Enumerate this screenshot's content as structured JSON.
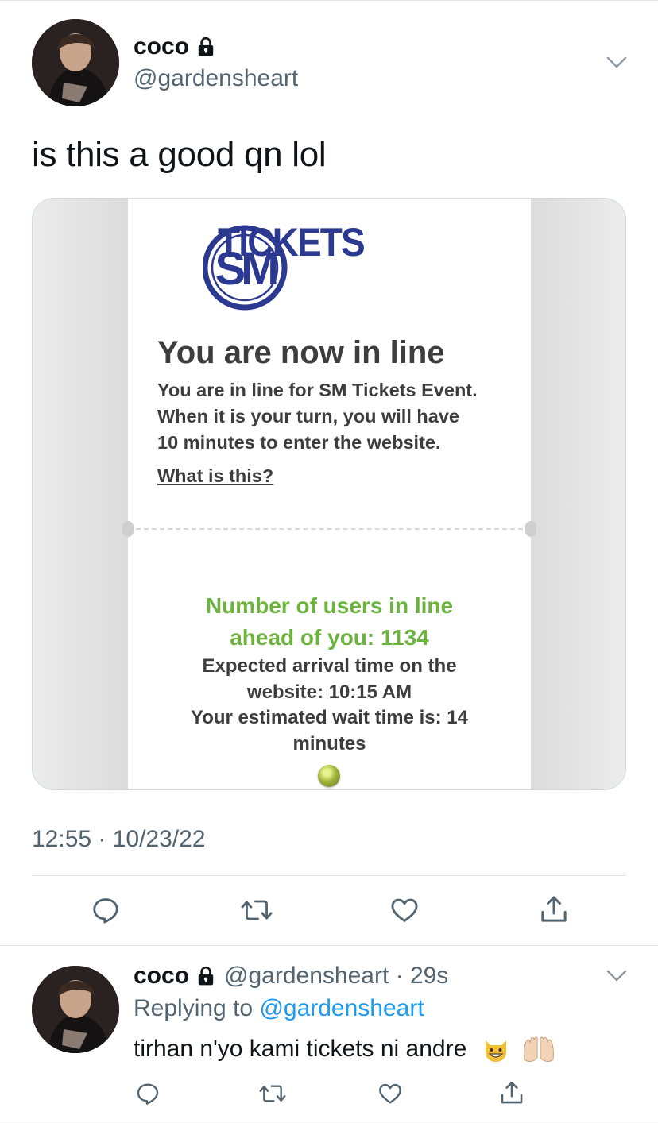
{
  "tweet": {
    "display_name": "coco",
    "handle": "@gardensheart",
    "text": "is this a good qn lol",
    "timestamp": "12:55 · 10/23/22",
    "icons": {
      "lock": "lock-icon",
      "more": "chevron-down-icon"
    }
  },
  "media": {
    "logo_text": "TICKETS",
    "logo_monogram": "SM",
    "headline": "You are now in line",
    "info_lines": [
      "You are in line for SM Tickets Event.",
      "When it is your turn, you will have",
      "10 minutes to enter the website."
    ],
    "what_link": "What is this?",
    "queue_lines": [
      "Number of users in line",
      "ahead of you: 1134"
    ],
    "arrival_lines": [
      "Expected arrival time on the",
      "website: 10:15 AM",
      "Your estimated wait time is: 14",
      "minutes"
    ],
    "colors": {
      "logo_blue": "#2b3990",
      "queue_green": "#6bb33c",
      "text_gray": "#3d3d3d"
    }
  },
  "actions": [
    "reply-icon",
    "retweet-icon",
    "like-icon",
    "share-icon"
  ],
  "reply": {
    "display_name": "coco",
    "handle_time": "@gardensheart · 29s",
    "replying_prefix": "Replying to ",
    "replying_handle": "@gardensheart",
    "text": "tirhan n'yo kami tickets ni andre",
    "emoji": [
      "grinning-cat-emoji",
      "raised-hands-emoji"
    ]
  },
  "colors": {
    "link_blue": "#1d9bf0",
    "secondary_gray": "#536471",
    "text_black": "#0f1419"
  }
}
